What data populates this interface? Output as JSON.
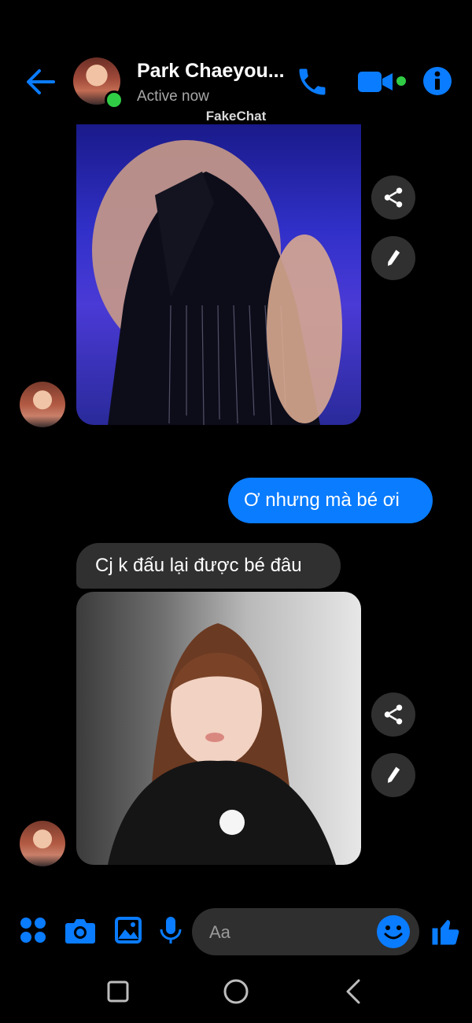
{
  "header": {
    "contact_name": "Park Chaeyou...",
    "status": "Active now",
    "watermark": "FakeChat"
  },
  "messages": [
    {
      "type": "image",
      "from": "contact",
      "caption": "",
      "description": "performance photo"
    },
    {
      "type": "text",
      "from": "me",
      "text": "Ơ nhưng mà bé ơi"
    },
    {
      "type": "text",
      "from": "contact",
      "text": "Cj k đấu lại được bé đâu"
    },
    {
      "type": "image",
      "from": "contact",
      "description": "portrait photo"
    }
  ],
  "composer": {
    "placeholder": "Aa"
  },
  "colors": {
    "accent": "#0a7cff",
    "online": "#31cc46",
    "incoming_bubble": "#303030",
    "background": "#000000"
  },
  "icons": [
    "back-arrow-icon",
    "phone-icon",
    "video-icon",
    "info-icon",
    "share-icon",
    "pencil-icon",
    "apps-icon",
    "camera-icon",
    "gallery-icon",
    "microphone-icon",
    "emoji-icon",
    "thumbs-up-icon",
    "square-icon",
    "circle-icon",
    "back-chevron-icon"
  ]
}
